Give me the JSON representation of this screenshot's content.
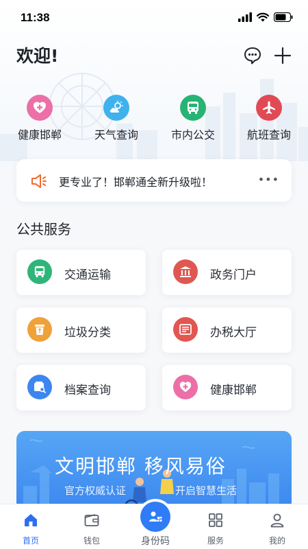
{
  "status_bar": {
    "time": "11:38"
  },
  "header": {
    "welcome": "欢迎!"
  },
  "quick_services": [
    {
      "label": "健康邯郸",
      "icon": "health-cross-icon",
      "color": "#ec6fa8"
    },
    {
      "label": "天气查询",
      "icon": "weather-icon",
      "color": "#3fb2ee"
    },
    {
      "label": "市内公交",
      "icon": "bus-icon",
      "color": "#27b374"
    },
    {
      "label": "航班查询",
      "icon": "airplane-icon",
      "color": "#e14a55"
    }
  ],
  "notice": {
    "text": "更专业了！邯郸通全新升级啦！",
    "more": "•••"
  },
  "public_services": {
    "title": "公共服务",
    "items": [
      {
        "label": "交通运输",
        "icon": "bus-icon",
        "color": "#2fb57a"
      },
      {
        "label": "政务门户",
        "icon": "government-building-icon",
        "color": "#e05752"
      },
      {
        "label": "垃圾分类",
        "icon": "trash-bin-icon",
        "color": "#f0a23a"
      },
      {
        "label": "办税大厅",
        "icon": "tax-icon",
        "color": "#e25651"
      },
      {
        "label": "档案查询",
        "icon": "archive-search-icon",
        "color": "#3d86ef"
      },
      {
        "label": "健康邯郸",
        "icon": "health-cross-icon",
        "color": "#ec6fa8"
      }
    ]
  },
  "banner": {
    "title": "文明邯郸   移风易俗",
    "subtitle_left": "官方权威认证",
    "subtitle_right": "开启智慧生活"
  },
  "tabbar": {
    "tabs": [
      {
        "label": "首页",
        "icon": "home-icon",
        "active": true
      },
      {
        "label": "钱包",
        "icon": "wallet-icon",
        "active": false
      },
      {
        "label": "身份码",
        "icon": "id-code-icon",
        "active": false
      },
      {
        "label": "服务",
        "icon": "grid-icon",
        "active": false
      },
      {
        "label": "我的",
        "icon": "profile-icon",
        "active": false
      }
    ]
  },
  "colors": {
    "accent": "#2b6ff0",
    "background": "#f7f8fa"
  }
}
